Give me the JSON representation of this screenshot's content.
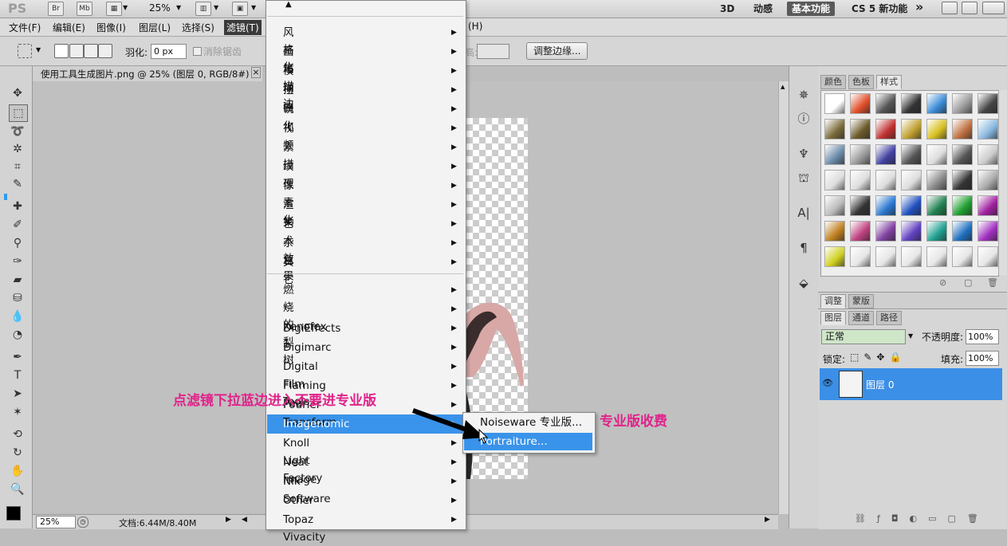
{
  "app": {
    "logo": "PS",
    "bridge_label": "Br",
    "minibridge_label": "Mb",
    "zoom": "25%",
    "workspaces": [
      "3D",
      "动感",
      "基本功能",
      "CS 5 新功能"
    ],
    "active_workspace": "基本功能",
    "more": "»"
  },
  "menubar": {
    "items": [
      "文件(F)",
      "编辑(E)",
      "图像(I)",
      "图层(L)",
      "选择(S)",
      "滤镜(T)"
    ],
    "trailing": "(H)"
  },
  "options": {
    "feather_label": "羽化:",
    "feather_value": "0 px",
    "antialias_label": "消除锯齿",
    "height_label": "高:",
    "refine_edge_label": "调整边缘..."
  },
  "document": {
    "tab_title": "使用工具生成图片.png @ 25% (图层 0, RGB/8#)",
    "close": "×",
    "status_zoom": "25%",
    "status_doc": "文档:6.44M/8.40M"
  },
  "filter_menu": {
    "top_arrow": "▲",
    "group1": [
      "风格化",
      "画笔描边",
      "模糊",
      "扭曲",
      "锐化",
      "视频",
      "素描",
      "纹理",
      "像素化",
      "渲染",
      "艺术效果",
      "杂色",
      "其它"
    ],
    "group2": [
      "燃烧的梨树",
      "* Xenofex 1",
      "DigiEffects",
      "Digimarc",
      "Digital Film Tools",
      "Flaming Pear",
      "Fourier Transform",
      "Imagenomic",
      "Knoll Light Factory",
      "Neat Image",
      "Nik Software",
      "Other",
      "Topaz Vivacity"
    ],
    "highlighted": "Imagenomic"
  },
  "submenu": {
    "items": [
      "Noiseware 专业版...",
      "Portraiture..."
    ],
    "highlighted": "Portraiture..."
  },
  "annotations": {
    "left": "点滤镜下拉蓝边进入不要进专业版",
    "right": "专业版收费"
  },
  "styles_panel": {
    "tabs": [
      "颜色",
      "色板",
      "样式"
    ],
    "active_tab": "样式"
  },
  "adjust_panel": {
    "tabs": [
      "调整",
      "蒙版"
    ]
  },
  "layers_panel": {
    "tabs": [
      "图层",
      "通道",
      "路径"
    ],
    "blend_mode": "正常",
    "opacity_label": "不透明度:",
    "opacity_value": "100%",
    "lock_label": "锁定:",
    "fill_label": "填充:",
    "fill_value": "100%",
    "layer_name": "图层 0"
  },
  "colors": {
    "highlight": "#3a93ea",
    "annotation": "#e0238a",
    "layer_selected": "#3b8fe6"
  }
}
